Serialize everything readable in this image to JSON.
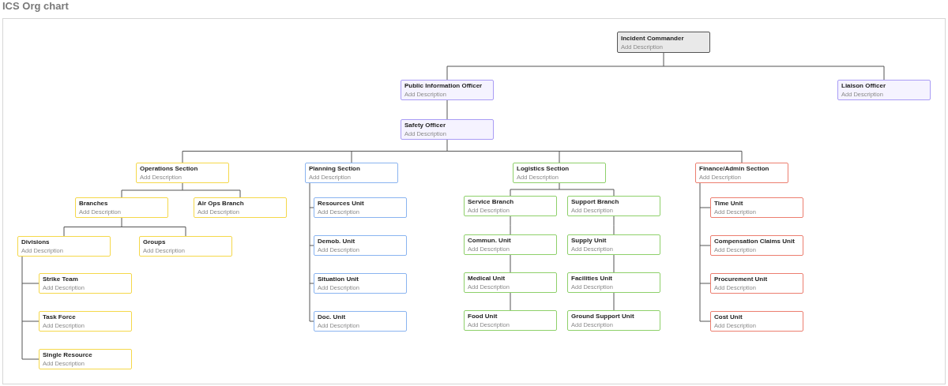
{
  "title": "ICS Org chart",
  "chart": {
    "root": {
      "name": "Incident Commander",
      "description": "Add Description",
      "kind": "commander",
      "color": "#555555",
      "children": [
        {
          "name": "Public Information Officer",
          "description": "Add Description",
          "kind": "officer",
          "color": "#a99cf5",
          "children": [
            {
              "name": "Safety Officer",
              "description": "Add Description",
              "kind": "officer",
              "color": "#a99cf5",
              "children": [
                {
                  "name": "Operations Section",
                  "description": "Add Description",
                  "kind": "unit",
                  "color": "#f5d84a",
                  "children": [
                    {
                      "name": "Branches",
                      "description": "Add Description",
                      "kind": "unit",
                      "color": "#f5d84a",
                      "children": [
                        {
                          "name": "Divisions",
                          "description": "Add Description",
                          "kind": "unit",
                          "color": "#f5d84a",
                          "children": [
                            {
                              "name": "Strike Team",
                              "description": "Add Description",
                              "kind": "unit",
                              "color": "#f5d84a"
                            },
                            {
                              "name": "Task Force",
                              "description": "Add Description",
                              "kind": "unit",
                              "color": "#f5d84a"
                            },
                            {
                              "name": "Single Resource",
                              "description": "Add Description",
                              "kind": "unit",
                              "color": "#f5d84a"
                            }
                          ]
                        },
                        {
                          "name": "Groups",
                          "description": "Add Description",
                          "kind": "unit",
                          "color": "#f5d84a"
                        }
                      ]
                    },
                    {
                      "name": "Air Ops Branch",
                      "description": "Add Description",
                      "kind": "unit",
                      "color": "#f5d84a"
                    }
                  ]
                },
                {
                  "name": "Planning Section",
                  "description": "Add Description",
                  "kind": "unit",
                  "color": "#8ab4f0",
                  "children": [
                    {
                      "name": "Resources Unit",
                      "description": "Add Description",
                      "kind": "unit",
                      "color": "#8ab4f0"
                    },
                    {
                      "name": "Demob. Unit",
                      "description": "Add Description",
                      "kind": "unit",
                      "color": "#8ab4f0"
                    },
                    {
                      "name": "Situation Unit",
                      "description": "Add Description",
                      "kind": "unit",
                      "color": "#8ab4f0"
                    },
                    {
                      "name": "Doc. Unit",
                      "description": "Add Description",
                      "kind": "unit",
                      "color": "#8ab4f0"
                    }
                  ]
                },
                {
                  "name": "Logistics Section",
                  "description": "Add Description",
                  "kind": "unit",
                  "color": "#8ed06a",
                  "children": [
                    {
                      "name": "Service Branch",
                      "description": "Add Description",
                      "kind": "unit",
                      "color": "#8ed06a",
                      "children": [
                        {
                          "name": "Commun. Unit",
                          "description": "Add Description",
                          "kind": "unit",
                          "color": "#8ed06a",
                          "children": [
                            {
                              "name": "Medical Unit",
                              "description": "Add Description",
                              "kind": "unit",
                              "color": "#8ed06a",
                              "children": [
                                {
                                  "name": "Food Unit",
                                  "description": "Add Description",
                                  "kind": "unit",
                                  "color": "#8ed06a"
                                }
                              ]
                            }
                          ]
                        }
                      ]
                    },
                    {
                      "name": "Support Branch",
                      "description": "Add Description",
                      "kind": "unit",
                      "color": "#8ed06a",
                      "children": [
                        {
                          "name": "Supply Unit",
                          "description": "Add Description",
                          "kind": "unit",
                          "color": "#8ed06a",
                          "children": [
                            {
                              "name": "Facilities Unit",
                              "description": "Add Description",
                              "kind": "unit",
                              "color": "#8ed06a",
                              "children": [
                                {
                                  "name": "Ground Support Unit",
                                  "description": "Add Description",
                                  "kind": "unit",
                                  "color": "#8ed06a"
                                }
                              ]
                            }
                          ]
                        }
                      ]
                    }
                  ]
                },
                {
                  "name": "Finance/Admin Section",
                  "description": "Add Description",
                  "kind": "unit",
                  "color": "#ec7e6f",
                  "children": [
                    {
                      "name": "Time Unit",
                      "description": "Add Description",
                      "kind": "unit",
                      "color": "#ec7e6f"
                    },
                    {
                      "name": "Compensation Claims Unit",
                      "description": "Add Description",
                      "kind": "unit",
                      "color": "#ec7e6f"
                    },
                    {
                      "name": "Procurement Unit",
                      "description": "Add Description",
                      "kind": "unit",
                      "color": "#ec7e6f"
                    },
                    {
                      "name": "Cost Unit",
                      "description": "Add Description",
                      "kind": "unit",
                      "color": "#ec7e6f"
                    }
                  ]
                }
              ]
            }
          ]
        },
        {
          "name": "Liaison Officer",
          "description": "Add Description",
          "kind": "officer",
          "color": "#a99cf5"
        }
      ]
    }
  }
}
